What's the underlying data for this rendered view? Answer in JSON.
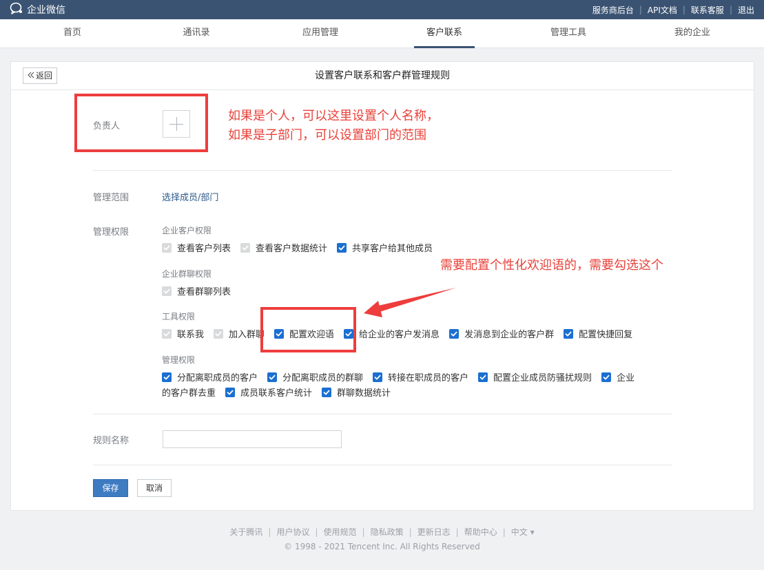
{
  "app": {
    "name": "企业微信",
    "logo_icon": "wecom-logo-icon"
  },
  "top_links": [
    "服务商后台",
    "API文档",
    "联系客服",
    "退出"
  ],
  "nav": {
    "items": [
      "首页",
      "通讯录",
      "应用管理",
      "客户联系",
      "管理工具",
      "我的企业"
    ],
    "active": "客户联系"
  },
  "page": {
    "back_label": "返回",
    "title": "设置客户联系和客户群管理规则"
  },
  "form": {
    "owner_label": "负责人",
    "scope_label": "管理范围",
    "scope_link": "选择成员/部门",
    "perm_label": "管理权限",
    "groups": [
      {
        "title": "企业客户权限",
        "items": [
          {
            "label": "查看客户列表",
            "state": "disabled-checked"
          },
          {
            "label": "查看客户数据统计",
            "state": "disabled-checked"
          },
          {
            "label": "共享客户给其他成员",
            "state": "checked"
          }
        ]
      },
      {
        "title": "企业群聊权限",
        "items": [
          {
            "label": "查看群聊列表",
            "state": "disabled-checked"
          }
        ]
      },
      {
        "title": "工具权限",
        "items": [
          {
            "label": "联系我",
            "state": "disabled-checked"
          },
          {
            "label": "加入群聊",
            "state": "disabled-checked"
          },
          {
            "label": "配置欢迎语",
            "state": "checked"
          },
          {
            "label": "给企业的客户发消息",
            "state": "checked"
          },
          {
            "label": "发消息到企业的客户群",
            "state": "checked"
          },
          {
            "label": "配置快捷回复",
            "state": "checked"
          }
        ]
      },
      {
        "title": "管理权限",
        "items": [
          {
            "label": "分配离职成员的客户",
            "state": "checked"
          },
          {
            "label": "分配离职成员的群聊",
            "state": "checked"
          },
          {
            "label": "转接在职成员的客户",
            "state": "checked"
          },
          {
            "label": "配置企业成员防骚扰规则",
            "state": "checked"
          },
          {
            "label": "企业的客户群去重",
            "state": "checked"
          },
          {
            "label": "成员联系客户统计",
            "state": "checked"
          },
          {
            "label": "群聊数据统计",
            "state": "checked"
          }
        ]
      }
    ],
    "rule_name_label": "规则名称",
    "rule_name_value": "",
    "save_label": "保存",
    "cancel_label": "取消"
  },
  "annotations": {
    "owner_note_line1": "如果是个人，可以这里设置个人名称，",
    "owner_note_line2": "如果是子部门，可以设置部门的范围",
    "welcome_note": "需要配置个性化欢迎语的，需要勾选这个"
  },
  "footer": {
    "links": [
      "关于腾讯",
      "用户协议",
      "使用规范",
      "隐私政策",
      "更新日志",
      "帮助中心",
      "中文 ▾"
    ],
    "copyright": "© 1998 - 2021 Tencent Inc. All Rights Reserved"
  },
  "colors": {
    "topbar": "#3b5373",
    "checkbox_checked": "#1b6fd1",
    "checkbox_disabled": "#d9dadc",
    "link": "#2c5a8c",
    "primary_button": "#3e7cc2",
    "annotation_red": "#ee3d3d"
  }
}
